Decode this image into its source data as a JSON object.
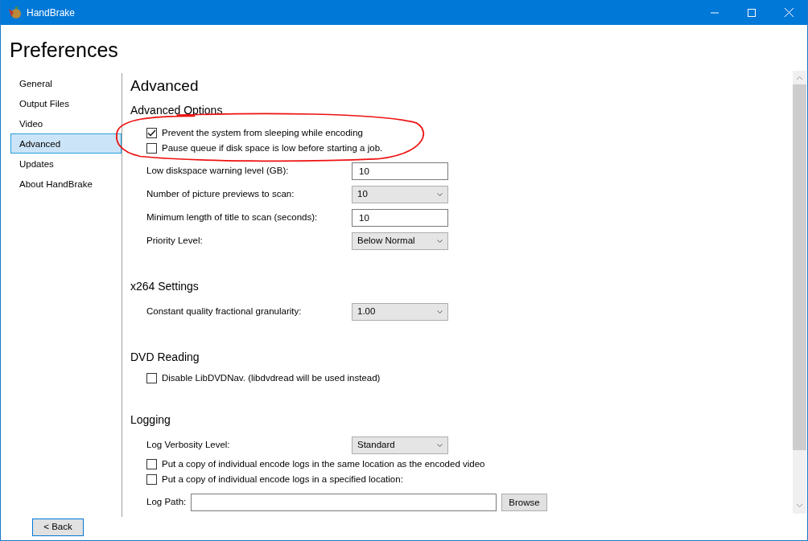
{
  "window": {
    "title": "HandBrake"
  },
  "page_title": "Preferences",
  "sidebar": {
    "items": [
      {
        "label": "General",
        "selected": false
      },
      {
        "label": "Output Files",
        "selected": false
      },
      {
        "label": "Video",
        "selected": false
      },
      {
        "label": "Advanced",
        "selected": true
      },
      {
        "label": "Updates",
        "selected": false
      },
      {
        "label": "About HandBrake",
        "selected": false
      }
    ]
  },
  "content": {
    "title": "Advanced",
    "sections": [
      {
        "heading": "Advanced Options",
        "rows": [
          {
            "kind": "checkbox",
            "label": "Prevent the system from sleeping while encoding",
            "checked": true
          },
          {
            "kind": "checkbox",
            "label": "Pause queue if disk space is low before starting a job.",
            "checked": false
          },
          {
            "kind": "text",
            "label": "Low diskspace warning level (GB):",
            "value": "10"
          },
          {
            "kind": "dropdown",
            "label": "Number of picture previews to scan:",
            "value": "10"
          },
          {
            "kind": "text",
            "label": "Minimum length of title to scan (seconds):",
            "value": "10"
          },
          {
            "kind": "dropdown",
            "label": "Priority Level:",
            "value": "Below Normal"
          }
        ]
      },
      {
        "heading": "x264 Settings",
        "rows": [
          {
            "kind": "dropdown",
            "label": "Constant quality fractional granularity:",
            "value": "1.00"
          }
        ]
      },
      {
        "heading": "DVD Reading",
        "rows": [
          {
            "kind": "checkbox",
            "label": "Disable LibDVDNav. (libdvdread will be used instead)",
            "checked": false
          }
        ]
      },
      {
        "heading": "Logging",
        "rows": [
          {
            "kind": "dropdown",
            "label": "Log Verbosity Level:",
            "value": "Standard"
          },
          {
            "kind": "checkbox",
            "label": "Put a copy of individual encode logs in the same location as the encoded video",
            "checked": false
          },
          {
            "kind": "checkbox",
            "label": "Put a copy of individual encode logs in a specified location:",
            "checked": false
          },
          {
            "kind": "path",
            "label": "Log Path:",
            "button": "Browse"
          }
        ]
      }
    ]
  },
  "back_button": "< Back"
}
